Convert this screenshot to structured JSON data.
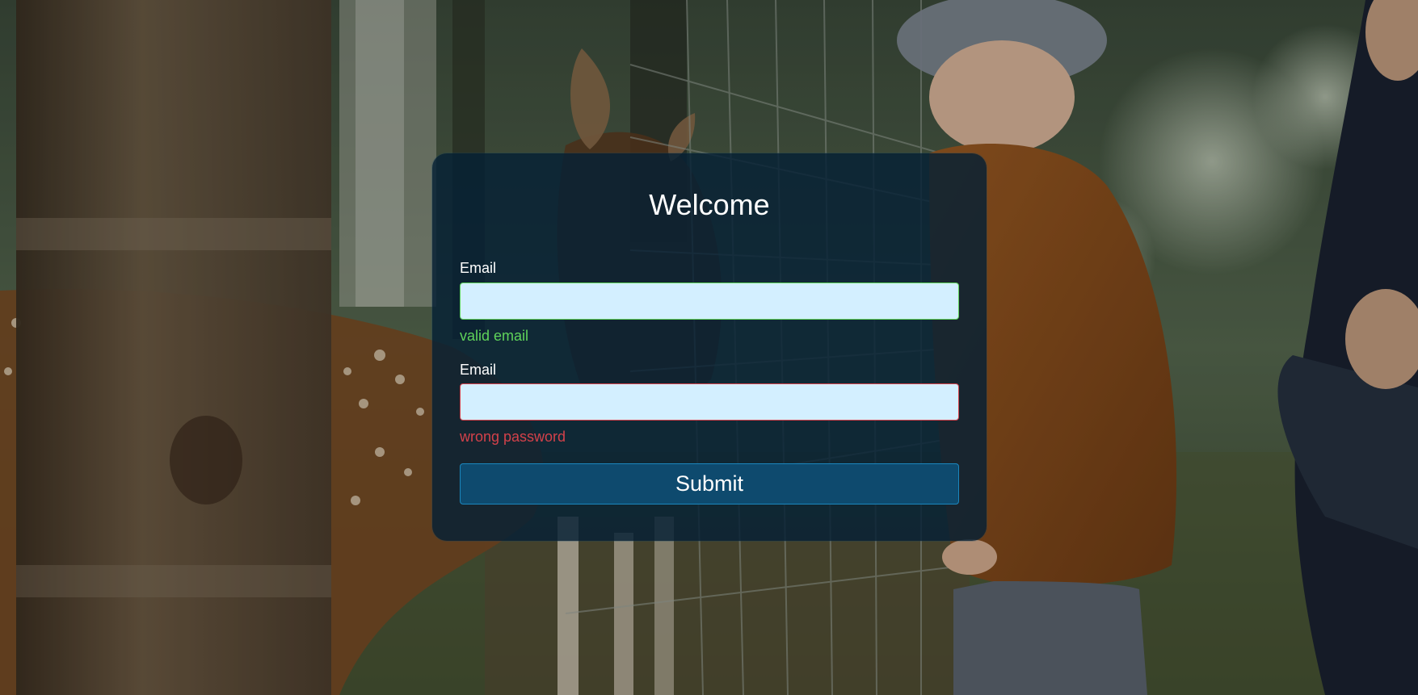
{
  "card": {
    "title": "Welcome"
  },
  "form": {
    "fields": [
      {
        "label": "Email",
        "value": "",
        "message": "valid email",
        "state": "valid"
      },
      {
        "label": "Email",
        "value": "",
        "message": "wrong password",
        "state": "invalid"
      }
    ],
    "submit_label": "Submit"
  },
  "colors": {
    "card_background": "#052034",
    "input_background": "#d3efff",
    "valid": "#5fd35a",
    "invalid": "#d3414a",
    "button_background": "#0e4a6e",
    "button_border": "#1b86bd"
  },
  "background": {
    "description_icon": "photo-background"
  }
}
